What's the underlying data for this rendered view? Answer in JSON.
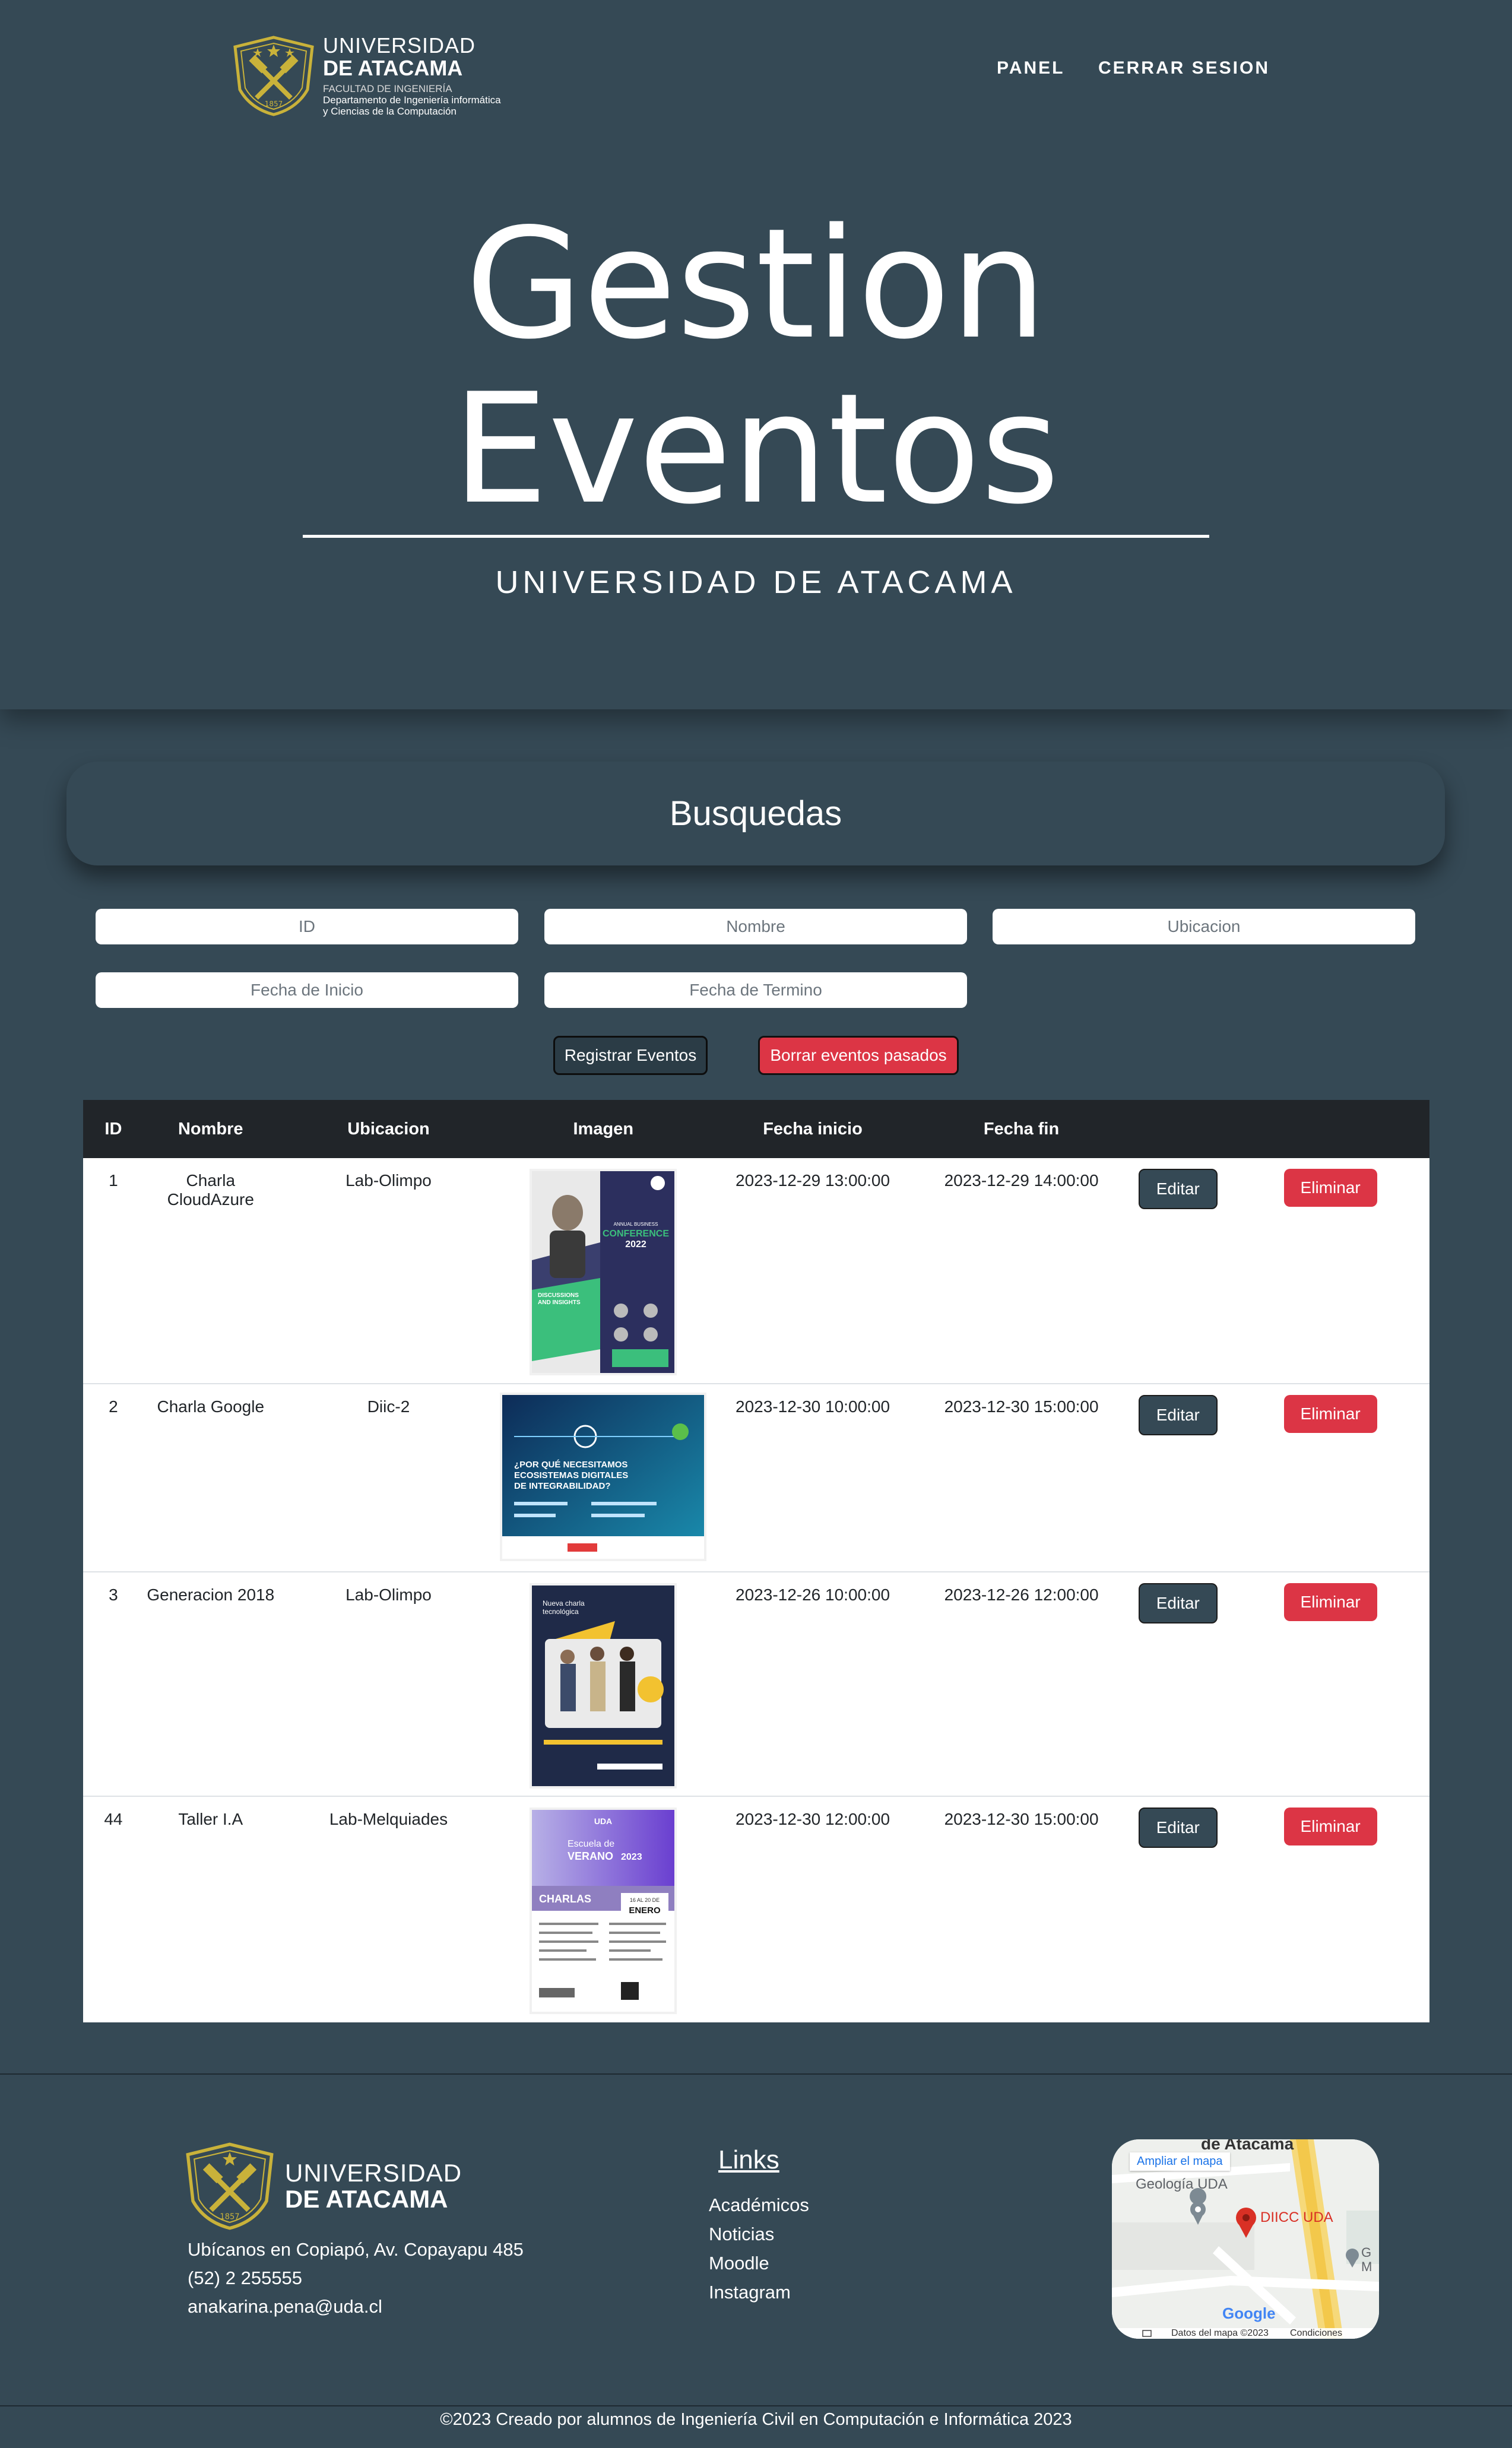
{
  "header": {
    "logo": {
      "line1": "UNIVERSIDAD",
      "line2": "DE ATACAMA",
      "line3": "FACULTAD DE INGENIERÍA",
      "line4": "Departamento de Ingeniería informática",
      "line5": "y Ciencias de la Computación",
      "seal_text": "UNIVERSIDAD DE ATACAMA 1857"
    },
    "nav": [
      "PANEL",
      "CERRAR SESION"
    ]
  },
  "hero": {
    "title_line1": "Gestion",
    "title_line2": "Eventos",
    "subtitle": "UNIVERSIDAD DE ATACAMA"
  },
  "search": {
    "title": "Busquedas",
    "placeholders": {
      "id": "ID",
      "nombre": "Nombre",
      "ubicacion": "Ubicacion",
      "fecha_inicio": "Fecha de Inicio",
      "fecha_termino": "Fecha de Termino"
    },
    "register_button": "Registrar Eventos",
    "delete_past_button": "Borrar eventos pasados"
  },
  "table": {
    "columns": [
      "ID",
      "Nombre",
      "Ubicacion",
      "Imagen",
      "Fecha inicio",
      "Fecha fin"
    ],
    "edit_label": "Editar",
    "delete_label": "Eliminar",
    "rows": [
      {
        "id": "1",
        "nombre": "Charla CloudAzure",
        "ubicacion": "Lab-Olimpo",
        "inicio": "2023-12-29 13:00:00",
        "fin": "2023-12-29 14:00:00"
      },
      {
        "id": "2",
        "nombre": "Charla Google",
        "ubicacion": "Diic-2",
        "inicio": "2023-12-30 10:00:00",
        "fin": "2023-12-30 15:00:00"
      },
      {
        "id": "3",
        "nombre": "Generacion 2018",
        "ubicacion": "Lab-Olimpo",
        "inicio": "2023-12-26 10:00:00",
        "fin": "2023-12-26 12:00:00"
      },
      {
        "id": "44",
        "nombre": "Taller I.A",
        "ubicacion": "Lab-Melquiades",
        "inicio": "2023-12-30 12:00:00",
        "fin": "2023-12-30 15:00:00"
      }
    ],
    "posters": {
      "p1": {
        "line1": "ANNUAL BUSINESS",
        "line2": "CONFERENCE",
        "line3": "2022",
        "line4": "DISCUSSIONS",
        "line5": "AND INSIGHTS"
      },
      "p2": {
        "line1": "¿POR QUÉ NECESITAMOS",
        "line2": "ECOSISTEMAS DIGITALES",
        "line3": "DE INTEGRABILIDAD?"
      },
      "p3": {
        "line1": "Nueva charla",
        "line2": "tecnológica"
      },
      "p4": {
        "line1": "UDA",
        "line2": "Escuela de",
        "line3": "VERANO",
        "line4": "2023",
        "line5": "CHARLAS",
        "line6": "16 AL 20 DE",
        "line7": "ENERO"
      }
    }
  },
  "footer": {
    "logo": {
      "line1": "UNIVERSIDAD",
      "line2": "DE ATACAMA"
    },
    "address": "Ubícanos en Copiapó, Av. Copayapu 485",
    "phone": "(52) 2 255555",
    "email": "anakarina.pena@uda.cl",
    "links_title": "Links",
    "links": [
      "Académicos",
      "Noticias",
      "Moodle",
      "Instagram"
    ],
    "map": {
      "top_label": "de Atacama",
      "enlarge": "Ampliar el mapa",
      "place1": "Geología UDA",
      "place2": "DIICC UDA",
      "place3": "G",
      "place3b": "M",
      "brand": "Google",
      "data": "Datos del mapa ©2023",
      "terms": "Condiciones"
    },
    "copyright": "©2023 Creado por alumnos de Ingeniería Civil en Computación e Informática 2023"
  },
  "colors": {
    "background": "#354955",
    "danger": "#dc3545",
    "table_header": "#212529",
    "logo_gold": "#c9b23a"
  }
}
